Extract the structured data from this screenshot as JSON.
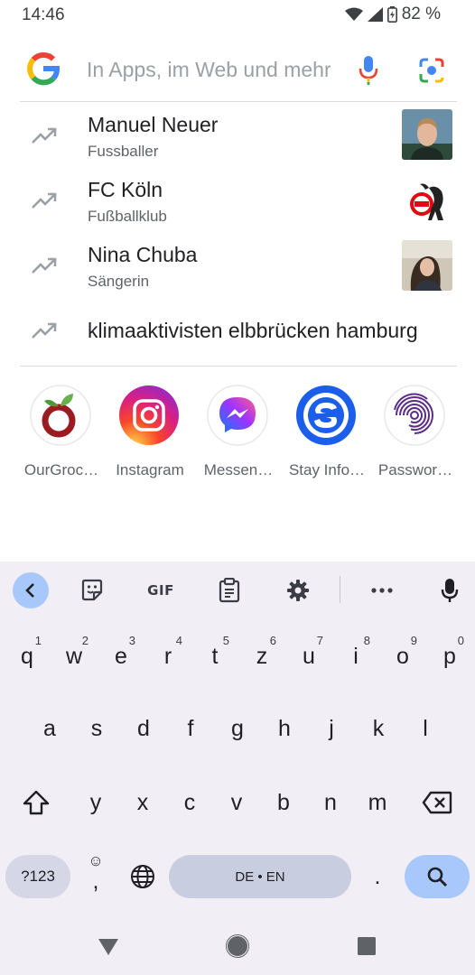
{
  "status_bar": {
    "time": "14:46",
    "battery": "82 %"
  },
  "search": {
    "placeholder": "In Apps, im Web und mehr suchen"
  },
  "suggestions": [
    {
      "title": "Manuel Neuer",
      "subtitle": "Fussballer",
      "icon": "trending-icon",
      "thumb": "person-photo"
    },
    {
      "title": "FC Köln",
      "subtitle": "Fußballklub",
      "icon": "trending-icon",
      "thumb": "club-logo"
    },
    {
      "title": "Nina Chuba",
      "subtitle": "Sängerin",
      "icon": "trending-icon",
      "thumb": "person-photo"
    },
    {
      "title": "klimaaktivisten elbbrücken hamburg",
      "icon": "trending-icon"
    }
  ],
  "apps": [
    {
      "label": "OurGroc…"
    },
    {
      "label": "Instagram"
    },
    {
      "label": "Messen…"
    },
    {
      "label": "Stay Info…"
    },
    {
      "label": "Passwor…"
    }
  ],
  "keyboard": {
    "toolbar": {
      "gif": "GIF"
    },
    "row1": [
      {
        "key": "q",
        "hint": "1"
      },
      {
        "key": "w",
        "hint": "2"
      },
      {
        "key": "e",
        "hint": "3"
      },
      {
        "key": "r",
        "hint": "4"
      },
      {
        "key": "t",
        "hint": "5"
      },
      {
        "key": "z",
        "hint": "6"
      },
      {
        "key": "u",
        "hint": "7"
      },
      {
        "key": "i",
        "hint": "8"
      },
      {
        "key": "o",
        "hint": "9"
      },
      {
        "key": "p",
        "hint": "0"
      }
    ],
    "row2": [
      "a",
      "s",
      "d",
      "f",
      "g",
      "h",
      "j",
      "k",
      "l"
    ],
    "row3": [
      "y",
      "x",
      "c",
      "v",
      "b",
      "n",
      "m"
    ],
    "bottom": {
      "sym_label": "?123",
      "comma": ",",
      "emoji": "☺",
      "space_label": "DE • EN",
      "period": "."
    }
  },
  "colors": {
    "accent": "#a8c7fa",
    "keyboard_bg": "#f1eef6"
  }
}
